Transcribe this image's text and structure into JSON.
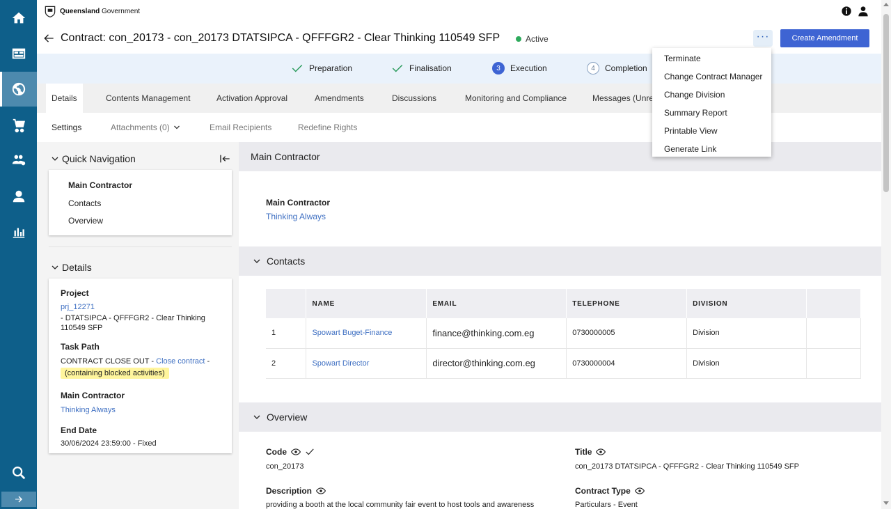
{
  "header": {
    "brand_bold": "Queensland",
    "brand_rest": " Government"
  },
  "sidebar": {
    "items": [
      {
        "icon": "home-icon"
      },
      {
        "icon": "dashboard-icon"
      },
      {
        "icon": "globe-handshake-icon",
        "active": true
      },
      {
        "icon": "cart-icon"
      },
      {
        "icon": "people-gear-icon"
      },
      {
        "icon": "user-icon"
      },
      {
        "icon": "bar-chart-icon"
      },
      {
        "icon": "search-icon"
      }
    ]
  },
  "title_bar": {
    "title": "Contract: con_20173 - con_20173 DTATSIPCA - QFFFGR2 - Clear Thinking 110549 SFP",
    "status": "Active",
    "more_label": "···",
    "create_amendment": "Create Amendment"
  },
  "steps": [
    {
      "label": "Preparation",
      "state": "done"
    },
    {
      "label": "Finalisation",
      "state": "done"
    },
    {
      "label": "Execution",
      "state": "current",
      "num": "3"
    },
    {
      "label": "Completion",
      "state": "future",
      "num": "4"
    }
  ],
  "tabs": [
    "Details",
    "Contents Management",
    "Activation Approval",
    "Amendments",
    "Discussions",
    "Monitoring and Compliance",
    "Messages (Unrea"
  ],
  "subtabs": [
    "Settings",
    "Attachments (0)",
    "Email Recipients",
    "Redefine Rights"
  ],
  "quick_nav": {
    "title": "Quick Navigation",
    "items": [
      "Main Contractor",
      "Contacts",
      "Overview"
    ]
  },
  "details": {
    "title": "Details",
    "project_label": "Project",
    "project_link": "prj_12271",
    "project_desc": "- DTATSIPCA - QFFFGR2 - Clear Thinking 110549 SFP",
    "task_path_label": "Task Path",
    "task_path_prefix": "CONTRACT CLOSE OUT -",
    "task_path_link": "Close contract",
    "task_path_suffix": "-",
    "task_path_note": "(containing blocked activities)",
    "main_contractor_label": "Main Contractor",
    "main_contractor_value": "Thinking Always",
    "end_date_label": "End Date",
    "end_date_value": "30/06/2024 23:59:00 - Fixed"
  },
  "main": {
    "main_contractor_section": "Main Contractor",
    "main_contractor_label": "Main Contractor",
    "main_contractor_value": "Thinking Always",
    "contacts_section": "Contacts",
    "contacts_columns": [
      "NAME",
      "EMAIL",
      "TELEPHONE",
      "DIVISION"
    ],
    "contacts": [
      {
        "index": "1",
        "name": "Spowart Buget-Finance",
        "email": "finance@thinking.com.eg",
        "telephone": "0730000005",
        "division": "Division"
      },
      {
        "index": "2",
        "name": "Spowart Director",
        "email": "director@thinking.com.eg",
        "telephone": "0730000004",
        "division": "Division"
      }
    ],
    "overview_section": "Overview",
    "code_label": "Code",
    "code_value": "con_20173",
    "title_label": "Title",
    "title_value": "con_20173 DTATSIPCA - QFFFGR2 - Clear Thinking 110549 SFP",
    "description_label": "Description",
    "description_value": "providing a booth at the local community fair event to host tools and awareness",
    "contract_type_label": "Contract Type",
    "contract_type_value": "Particulars - Event"
  },
  "menu": {
    "items": [
      "Terminate",
      "Change Contract Manager",
      "Change Division",
      "Summary Report",
      "Printable View",
      "Generate Link"
    ]
  }
}
